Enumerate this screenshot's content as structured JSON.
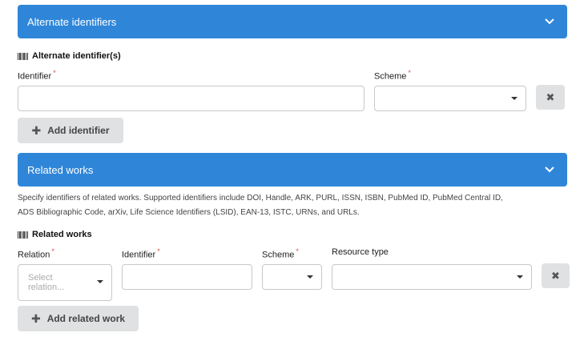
{
  "alternate": {
    "header": "Alternate identifiers",
    "section_title": "Alternate identifier(s)",
    "identifier_label": "Identifier",
    "scheme_label": "Scheme",
    "required_mark": "*",
    "remove_glyph": "✖",
    "add_label": "Add identifier",
    "add_glyph": "✚"
  },
  "related": {
    "header": "Related works",
    "help_line1": "Specify identifiers of related works. Supported identifiers include DOI, Handle, ARK, PURL, ISSN, ISBN, PubMed ID, PubMed Central ID,",
    "help_line2": "ADS Bibliographic Code, arXiv, Life Science Identifiers (LSID), EAN-13, ISTC, URNs, and URLs.",
    "section_title": "Related works",
    "relation_label": "Relation",
    "relation_placeholder_line1": "Select",
    "relation_placeholder_line2": "relation...",
    "identifier_label": "Identifier",
    "scheme_label": "Scheme",
    "resource_type_label": "Resource type",
    "required_mark": "*",
    "remove_glyph": "✖",
    "add_label": "Add related work",
    "add_glyph": "✚"
  },
  "colors": {
    "header_bg": "#2f86d9",
    "button_bg": "#e0e1e2",
    "required": "#d9534f"
  },
  "icons": {
    "chevron": "chevron-down-icon",
    "barcode": "barcode-icon",
    "remove": "close-icon",
    "add": "plus-icon"
  }
}
